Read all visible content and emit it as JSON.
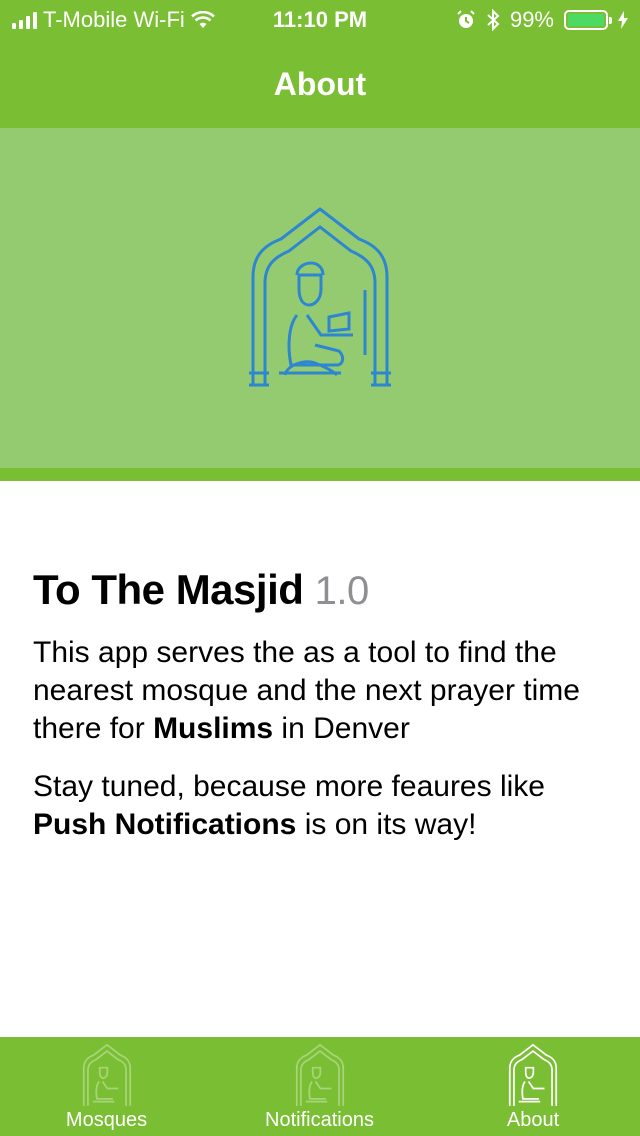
{
  "status": {
    "carrier": "T-Mobile Wi-Fi",
    "time": "11:10 PM",
    "battery": "99%",
    "battery_level": 0.99
  },
  "nav": {
    "title": "About"
  },
  "hero": {
    "icon": "mosque-prayer-icon"
  },
  "about": {
    "app_name": "To The Masjid",
    "version": "1.0",
    "p1_text": "This app serves the as a tool to find the nearest mosque and the next prayer time there for ",
    "p1_bold": "Muslims",
    "p1_end": " in Denver",
    "p2_text": "Stay tuned, because more feaures like ",
    "p2_bold": "Push Notifications",
    "p2_end": " is on its way!"
  },
  "tabs": [
    {
      "label": "Mosques",
      "icon": "mosque-prayer-icon",
      "active": false
    },
    {
      "label": "Notifications",
      "icon": "mosque-prayer-icon",
      "active": false
    },
    {
      "label": "About",
      "icon": "mosque-prayer-icon",
      "active": true
    }
  ],
  "colors": {
    "header": "#7ABE33",
    "hero": "#94CB71",
    "icon_stroke": "#2E86D1"
  }
}
